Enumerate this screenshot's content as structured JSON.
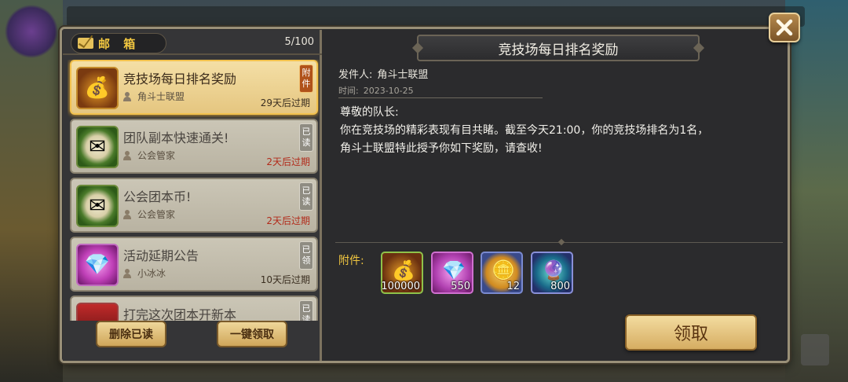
{
  "mailbox": {
    "title": "邮 箱",
    "count": "5/100",
    "items": [
      {
        "title": "竞技场每日排名奖励",
        "sender": "角斗士联盟",
        "expire": "29天后过期",
        "badge": "附件",
        "state": "active"
      },
      {
        "title": "团队副本快速通关!",
        "sender": "公会管家",
        "expire": "2天后过期",
        "badge": "已读",
        "state": "read"
      },
      {
        "title": "公会团本币!",
        "sender": "公会管家",
        "expire": "2天后过期",
        "badge": "已读",
        "state": "read"
      },
      {
        "title": "活动延期公告",
        "sender": "小冰冰",
        "expire": "10天后过期",
        "badge": "已领",
        "state": "claimed"
      },
      {
        "title": "打完这次团本开新本",
        "badge": "已读"
      }
    ],
    "delete_read_label": "删除已读",
    "claim_all_label": "一键领取"
  },
  "detail": {
    "title": "竞技场每日排名奖励",
    "sender_label": "发件人:",
    "sender": "角斗士联盟",
    "date_label": "时间:",
    "date": "2023-10-25",
    "body": [
      "尊敬的队长:",
      "你在竞技场的精彩表现有目共睹。截至今天21:00，你的竞技场排名为1名，",
      "角斗士联盟特此授予你如下奖励，请查收!"
    ],
    "attachments_label": "附件:",
    "rewards": [
      {
        "icon": "gold-coins-icon",
        "count": "100000"
      },
      {
        "icon": "diamond-icon",
        "count": "550"
      },
      {
        "icon": "arena-coin-icon",
        "count": "12"
      },
      {
        "icon": "magic-orb-icon",
        "count": "800"
      }
    ],
    "claim_label": "领取"
  },
  "colors": {
    "accent_gold": "#f1c640",
    "panel_bg": "#2b2b2d",
    "expire_red": "#b22a1a"
  }
}
